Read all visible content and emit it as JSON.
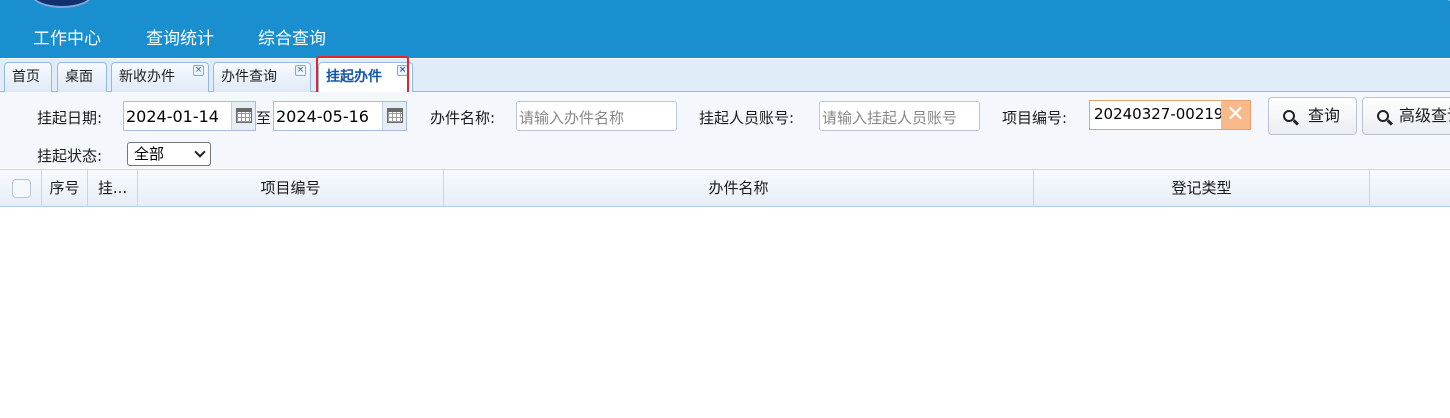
{
  "header": {
    "menu": [
      {
        "label": "工作中心"
      },
      {
        "label": "查询统计"
      },
      {
        "label": "综合查询"
      }
    ]
  },
  "tabs": [
    {
      "label": "首页",
      "closable": false,
      "active": false
    },
    {
      "label": "桌面",
      "closable": false,
      "active": false
    },
    {
      "label": "新收办件",
      "closable": true,
      "active": false
    },
    {
      "label": "办件查询",
      "closable": true,
      "active": false
    },
    {
      "label": "挂起办件",
      "closable": true,
      "active": true
    }
  ],
  "filters": {
    "date_label": "挂起日期:",
    "date_from": "2024-01-14",
    "date_sep": "至",
    "date_to": "2024-05-16",
    "name_label": "办件名称:",
    "name_placeholder": "请输入办件名称",
    "account_label": "挂起人员账号:",
    "account_placeholder": "请输入挂起人员账号",
    "project_label": "项目编号:",
    "project_value": "20240327-00219",
    "status_label": "挂起状态:",
    "status_selected": "全部",
    "search_button": "查询",
    "advanced_button": "高级查询"
  },
  "grid": {
    "columns": [
      "序号",
      "挂...",
      "项目编号",
      "办件名称",
      "登记类型"
    ],
    "rows": []
  },
  "colors": {
    "header_bg": "#1a8fd0",
    "highlight": "#e3262a",
    "clear_button": "#f8b98b"
  }
}
